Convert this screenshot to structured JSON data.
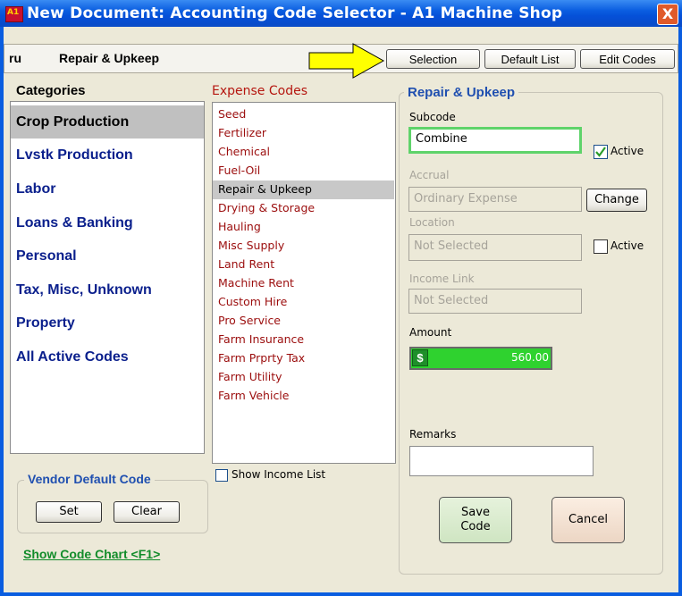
{
  "window": {
    "title": "New Document: Accounting Code Selector - A1 Machine Shop",
    "app_icon": "A1",
    "close_label": "X"
  },
  "toolbar": {
    "code": "ru",
    "label": "Repair & Upkeep",
    "selection_btn": "Selection",
    "default_list_btn": "Default List",
    "edit_codes_btn": "Edit Codes",
    "arrow_color": "#ffff00"
  },
  "categories": {
    "heading": "Categories",
    "selected": "Crop Production",
    "items": [
      {
        "label": "Crop Production"
      },
      {
        "label": "Lvstk Production"
      },
      {
        "label": "Labor"
      },
      {
        "label": "Loans & Banking"
      },
      {
        "label": "Personal"
      },
      {
        "label": "Tax, Misc, Unknown"
      },
      {
        "label": "Property"
      },
      {
        "label": "All Active Codes"
      }
    ]
  },
  "expense_codes": {
    "heading": "Expense Codes",
    "selected": "Repair & Upkeep",
    "items": [
      {
        "label": "Seed"
      },
      {
        "label": "Fertilizer"
      },
      {
        "label": "Chemical"
      },
      {
        "label": "Fuel-Oil"
      },
      {
        "label": "Repair & Upkeep"
      },
      {
        "label": "Drying & Storage"
      },
      {
        "label": "Hauling"
      },
      {
        "label": "Misc Supply"
      },
      {
        "label": "Land Rent"
      },
      {
        "label": "Machine Rent"
      },
      {
        "label": "Custom Hire"
      },
      {
        "label": "Pro Service"
      },
      {
        "label": "Farm Insurance"
      },
      {
        "label": "Farm Prprty Tax"
      },
      {
        "label": "Farm Utility"
      },
      {
        "label": "Farm Vehicle"
      }
    ],
    "show_income_label": "Show Income List",
    "show_income_checked": false
  },
  "detail": {
    "title": "Repair & Upkeep",
    "subcode_label": "Subcode",
    "subcode_value": "Combine",
    "subcode_active_label": "Active",
    "subcode_active_checked": true,
    "accrual_label": "Accrual",
    "accrual_value": "Ordinary Expense",
    "change_btn": "Change",
    "location_label": "Location",
    "location_value": "Not Selected",
    "location_active_label": "Active",
    "location_active_checked": false,
    "income_link_label": "Income Link",
    "income_link_value": "Not Selected",
    "amount_label": "Amount",
    "amount_value": "560.00",
    "remarks_label": "Remarks",
    "remarks_value": "",
    "save_btn_line1": "Save",
    "save_btn_line2": "Code",
    "cancel_btn": "Cancel"
  },
  "vendor": {
    "title": "Vendor Default Code",
    "set_btn": "Set",
    "clear_btn": "Clear"
  },
  "show_chart_link": "Show Code Chart <F1>"
}
